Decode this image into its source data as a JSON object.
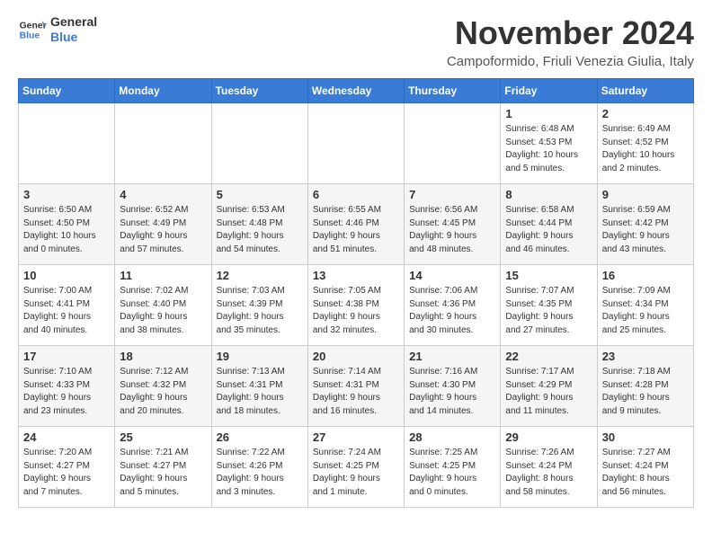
{
  "logo": {
    "line1": "General",
    "line2": "Blue"
  },
  "header": {
    "month": "November 2024",
    "location": "Campoformido, Friuli Venezia Giulia, Italy"
  },
  "weekdays": [
    "Sunday",
    "Monday",
    "Tuesday",
    "Wednesday",
    "Thursday",
    "Friday",
    "Saturday"
  ],
  "weeks": [
    [
      {
        "day": "",
        "info": ""
      },
      {
        "day": "",
        "info": ""
      },
      {
        "day": "",
        "info": ""
      },
      {
        "day": "",
        "info": ""
      },
      {
        "day": "",
        "info": ""
      },
      {
        "day": "1",
        "info": "Sunrise: 6:48 AM\nSunset: 4:53 PM\nDaylight: 10 hours\nand 5 minutes."
      },
      {
        "day": "2",
        "info": "Sunrise: 6:49 AM\nSunset: 4:52 PM\nDaylight: 10 hours\nand 2 minutes."
      }
    ],
    [
      {
        "day": "3",
        "info": "Sunrise: 6:50 AM\nSunset: 4:50 PM\nDaylight: 10 hours\nand 0 minutes."
      },
      {
        "day": "4",
        "info": "Sunrise: 6:52 AM\nSunset: 4:49 PM\nDaylight: 9 hours\nand 57 minutes."
      },
      {
        "day": "5",
        "info": "Sunrise: 6:53 AM\nSunset: 4:48 PM\nDaylight: 9 hours\nand 54 minutes."
      },
      {
        "day": "6",
        "info": "Sunrise: 6:55 AM\nSunset: 4:46 PM\nDaylight: 9 hours\nand 51 minutes."
      },
      {
        "day": "7",
        "info": "Sunrise: 6:56 AM\nSunset: 4:45 PM\nDaylight: 9 hours\nand 48 minutes."
      },
      {
        "day": "8",
        "info": "Sunrise: 6:58 AM\nSunset: 4:44 PM\nDaylight: 9 hours\nand 46 minutes."
      },
      {
        "day": "9",
        "info": "Sunrise: 6:59 AM\nSunset: 4:42 PM\nDaylight: 9 hours\nand 43 minutes."
      }
    ],
    [
      {
        "day": "10",
        "info": "Sunrise: 7:00 AM\nSunset: 4:41 PM\nDaylight: 9 hours\nand 40 minutes."
      },
      {
        "day": "11",
        "info": "Sunrise: 7:02 AM\nSunset: 4:40 PM\nDaylight: 9 hours\nand 38 minutes."
      },
      {
        "day": "12",
        "info": "Sunrise: 7:03 AM\nSunset: 4:39 PM\nDaylight: 9 hours\nand 35 minutes."
      },
      {
        "day": "13",
        "info": "Sunrise: 7:05 AM\nSunset: 4:38 PM\nDaylight: 9 hours\nand 32 minutes."
      },
      {
        "day": "14",
        "info": "Sunrise: 7:06 AM\nSunset: 4:36 PM\nDaylight: 9 hours\nand 30 minutes."
      },
      {
        "day": "15",
        "info": "Sunrise: 7:07 AM\nSunset: 4:35 PM\nDaylight: 9 hours\nand 27 minutes."
      },
      {
        "day": "16",
        "info": "Sunrise: 7:09 AM\nSunset: 4:34 PM\nDaylight: 9 hours\nand 25 minutes."
      }
    ],
    [
      {
        "day": "17",
        "info": "Sunrise: 7:10 AM\nSunset: 4:33 PM\nDaylight: 9 hours\nand 23 minutes."
      },
      {
        "day": "18",
        "info": "Sunrise: 7:12 AM\nSunset: 4:32 PM\nDaylight: 9 hours\nand 20 minutes."
      },
      {
        "day": "19",
        "info": "Sunrise: 7:13 AM\nSunset: 4:31 PM\nDaylight: 9 hours\nand 18 minutes."
      },
      {
        "day": "20",
        "info": "Sunrise: 7:14 AM\nSunset: 4:31 PM\nDaylight: 9 hours\nand 16 minutes."
      },
      {
        "day": "21",
        "info": "Sunrise: 7:16 AM\nSunset: 4:30 PM\nDaylight: 9 hours\nand 14 minutes."
      },
      {
        "day": "22",
        "info": "Sunrise: 7:17 AM\nSunset: 4:29 PM\nDaylight: 9 hours\nand 11 minutes."
      },
      {
        "day": "23",
        "info": "Sunrise: 7:18 AM\nSunset: 4:28 PM\nDaylight: 9 hours\nand 9 minutes."
      }
    ],
    [
      {
        "day": "24",
        "info": "Sunrise: 7:20 AM\nSunset: 4:27 PM\nDaylight: 9 hours\nand 7 minutes."
      },
      {
        "day": "25",
        "info": "Sunrise: 7:21 AM\nSunset: 4:27 PM\nDaylight: 9 hours\nand 5 minutes."
      },
      {
        "day": "26",
        "info": "Sunrise: 7:22 AM\nSunset: 4:26 PM\nDaylight: 9 hours\nand 3 minutes."
      },
      {
        "day": "27",
        "info": "Sunrise: 7:24 AM\nSunset: 4:25 PM\nDaylight: 9 hours\nand 1 minute."
      },
      {
        "day": "28",
        "info": "Sunrise: 7:25 AM\nSunset: 4:25 PM\nDaylight: 9 hours\nand 0 minutes."
      },
      {
        "day": "29",
        "info": "Sunrise: 7:26 AM\nSunset: 4:24 PM\nDaylight: 8 hours\nand 58 minutes."
      },
      {
        "day": "30",
        "info": "Sunrise: 7:27 AM\nSunset: 4:24 PM\nDaylight: 8 hours\nand 56 minutes."
      }
    ]
  ]
}
